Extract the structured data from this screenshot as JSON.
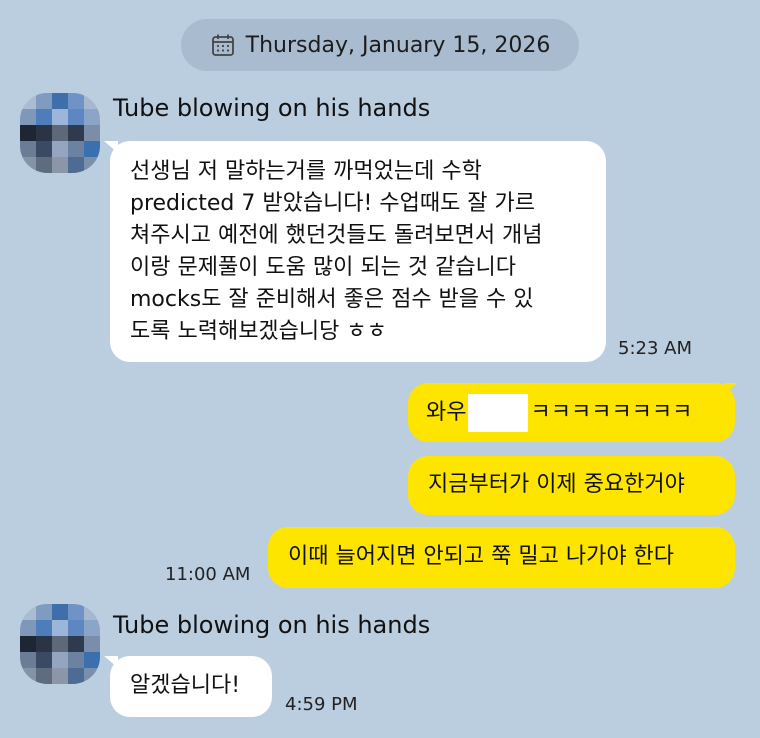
{
  "date_separator": {
    "icon": "calendar-icon",
    "text": "Thursday, January 15, 2026"
  },
  "messages": [
    {
      "sender": "Tube blowing on his hands",
      "direction": "incoming",
      "lines": [
        "선생님 저 말하는거를 까먹었는데 수학",
        "predicted 7 받았습니다! 수업때도 잘 가르",
        "쳐주시고 예전에 했던것들도 돌려보면서 개념",
        "이랑 문제풀이 도움 많이 되는 것 같습니다",
        "mocks도 잘 준비해서 좋은 점수 받을 수 있",
        "도록 노력해보겠습니당 ㅎㅎ"
      ],
      "time": "5:23 AM"
    },
    {
      "direction": "outgoing",
      "prefix": "와우",
      "suffix": "ㅋㅋㅋㅋㅋㅋㅋㅋ"
    },
    {
      "direction": "outgoing",
      "text": "지금부터가 이제 중요한거야"
    },
    {
      "direction": "outgoing",
      "text": "이때 늘어지면 안되고 쭉 밀고 나가야 한다",
      "time": "11:00 AM"
    },
    {
      "sender": "Tube blowing on his hands",
      "direction": "incoming",
      "text": "알겠습니다!",
      "time": "4:59 PM"
    }
  ],
  "colors": {
    "background": "#bacee0",
    "incoming_bubble": "#ffffff",
    "outgoing_bubble": "#fee500",
    "date_pill": "#a9bccf"
  }
}
